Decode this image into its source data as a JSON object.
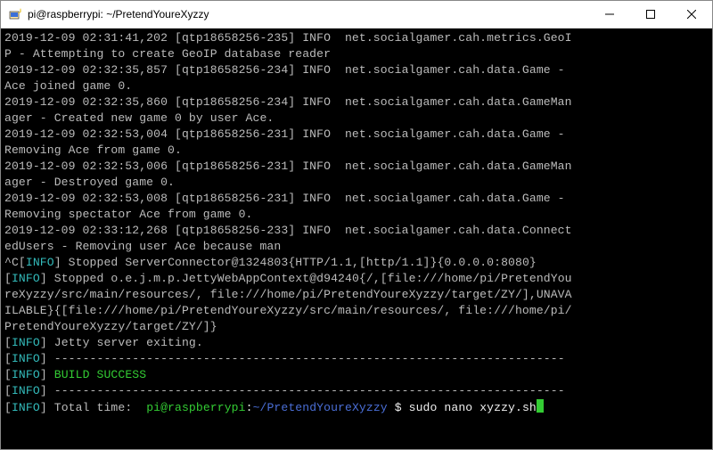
{
  "titlebar": {
    "title": "pi@raspberrypi: ~/PretendYoureXyzzy"
  },
  "log": {
    "l01a": "2019-12-09 02:31:41,202 [qtp18658256-235] INFO  net.socialgamer.cah.metrics.GeoI",
    "l01b": "P - Attempting to create GeoIP database reader",
    "l02a": "2019-12-09 02:32:35,857 [qtp18658256-234] INFO  net.socialgamer.cah.data.Game - ",
    "l02b": "Ace joined game 0.",
    "l03a": "2019-12-09 02:32:35,860 [qtp18658256-234] INFO  net.socialgamer.cah.data.GameMan",
    "l03b": "ager - Created new game 0 by user Ace.",
    "l04a": "2019-12-09 02:32:53,004 [qtp18658256-231] INFO  net.socialgamer.cah.data.Game - ",
    "l04b": "Removing Ace from game 0.",
    "l05a": "2019-12-09 02:32:53,006 [qtp18658256-231] INFO  net.socialgamer.cah.data.GameMan",
    "l05b": "ager - Destroyed game 0.",
    "l06a": "2019-12-09 02:32:53,008 [qtp18658256-231] INFO  net.socialgamer.cah.data.Game - ",
    "l06b": "Removing spectator Ace from game 0.",
    "l07a": "2019-12-09 02:33:12,268 [qtp18658256-233] INFO  net.socialgamer.cah.data.Connect",
    "l07b": "edUsers - Removing user Ace because man",
    "ctrlC": "^C",
    "bracketL": "[",
    "bracketR": "]",
    "info": "INFO",
    "stopConn": " Stopped ServerConnector@1324803{HTTP/1.1,[http/1.1]}{0.0.0.0:8080}",
    "stopCtx1": " Stopped o.e.j.m.p.JettyWebAppContext@d94240{/,[file:///home/pi/PretendYou",
    "stopCtx2": "reXyzzy/src/main/resources/, file:///home/pi/PretendYoureXyzzy/target/ZY/],UNAVA",
    "stopCtx3": "ILABLE}{[file:///home/pi/PretendYoureXyzzy/src/main/resources/, file:///home/pi/",
    "stopCtx4": "PretendYoureXyzzy/target/ZY/]}",
    "jettyExit": " Jetty server exiting.",
    "sep": " ------------------------------------------------------------------------",
    "buildSuccess": "BUILD SUCCESS",
    "totalTime": " Total time:  "
  },
  "prompt": {
    "userHost": "pi@raspberrypi",
    "colon": ":",
    "path": "~/PretendYoureXyzzy",
    "dollar": " $ ",
    "command": "sudo nano xyzzy.sh"
  }
}
